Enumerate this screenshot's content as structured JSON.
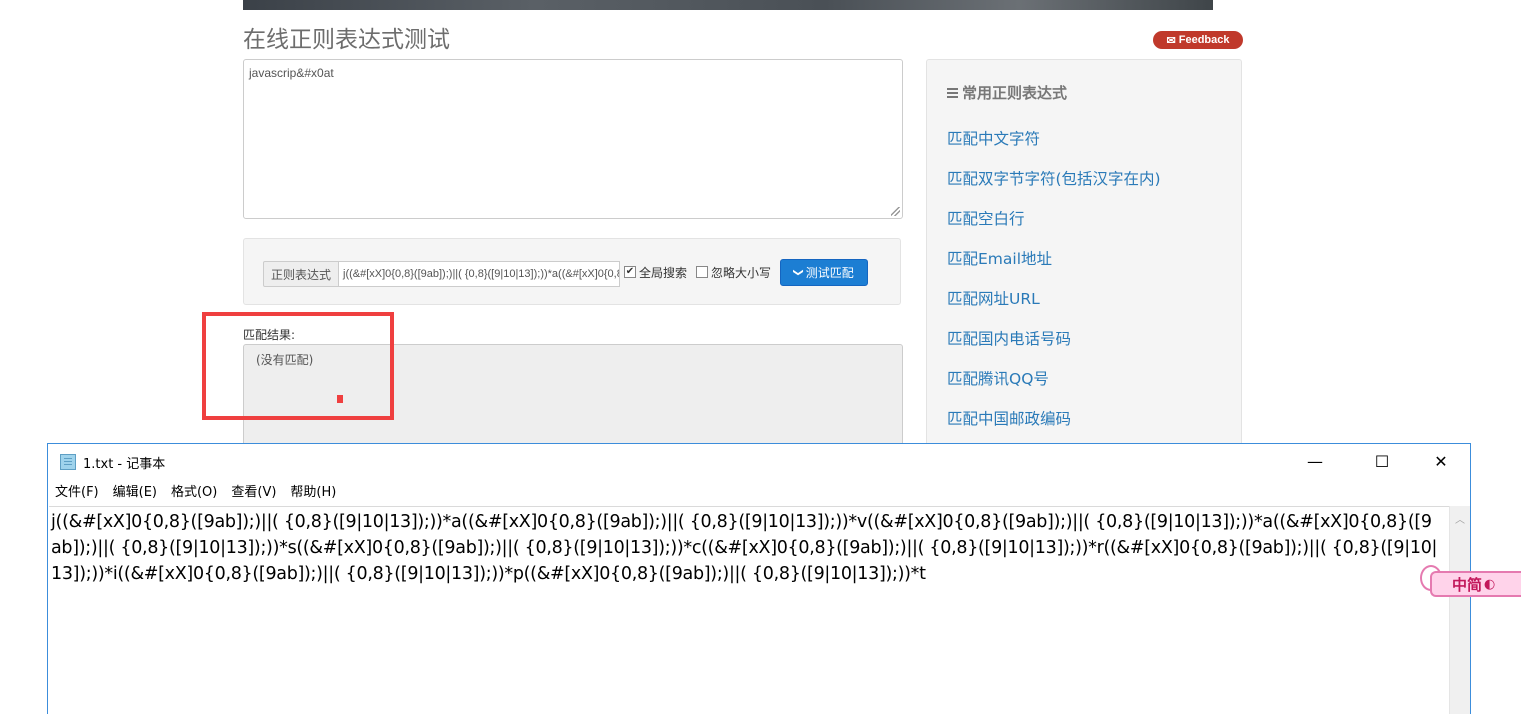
{
  "page": {
    "title": "在线正则表达式测试",
    "feedback_label": "Feedback",
    "input_text": "javascrip&#x0at"
  },
  "regex_panel": {
    "label": "正则表达式",
    "value": "j((&#[xX]0{0,8}([9ab]);)||( {0,8}([9|10|13]);))*a((&#[xX]0{0,8}([9ab]);)||( {0,8}([9|10|13]);))*",
    "global_label": "全局搜索",
    "global_checked": "✔",
    "ignore_case_label": "忽略大小写",
    "button_label": "测试匹配",
    "button_icon": "❯"
  },
  "result": {
    "label": "匹配结果:",
    "value": "(没有匹配)"
  },
  "sidebar": {
    "title": "常用正则表达式",
    "links": [
      "匹配中文字符",
      "匹配双字节字符(包括汉字在内)",
      "匹配空白行",
      "匹配Email地址",
      "匹配网址URL",
      "匹配国内电话号码",
      "匹配腾讯QQ号",
      "匹配中国邮政编码"
    ]
  },
  "notepad": {
    "title": "1.txt - 记事本",
    "menu": [
      "文件(F)",
      "编辑(E)",
      "格式(O)",
      "查看(V)",
      "帮助(H)"
    ],
    "content": "j((&#[xX]0{0,8}([9ab]);)||( {0,8}([9|10|13]);))*a((&#[xX]0{0,8}([9ab]);)||( {0,8}([9|10|13]);))*v((&#[xX]0{0,8}([9ab]);)||( {0,8}([9|10|13]);))*a((&#[xX]0{0,8}([9ab]);)||( {0,8}([9|10|13]);))*s((&#[xX]0{0,8}([9ab]);)||( {0,8}([9|10|13]);))*c((&#[xX]0{0,8}([9ab]);)||( {0,8}([9|10|13]);))*r((&#[xX]0{0,8}([9ab]);)||( {0,8}([9|10|13]);))*i((&#[xX]0{0,8}([9ab]);)||( {0,8}([9|10|13]);))*p((&#[xX]0{0,8}([9ab]);)||( {0,8}([9|10|13]);))*t",
    "minimize_glyph": "—",
    "maximize_glyph": "☐",
    "close_glyph": "✕"
  },
  "ime": {
    "label": "中简",
    "mode_glyph": "◐"
  },
  "colors": {
    "annotation_red": "#ef3f3f",
    "link_blue": "#2a7ab8",
    "button_blue": "#1c7ed3",
    "feedback_red": "#c0392b"
  }
}
